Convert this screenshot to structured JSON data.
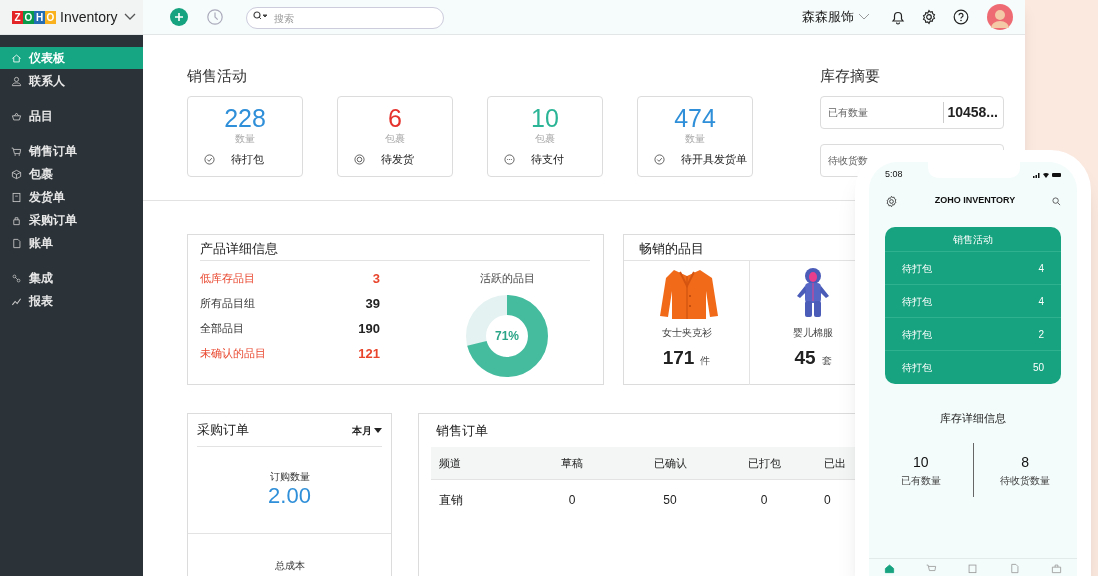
{
  "header": {
    "logo_letters": [
      "Z",
      "O",
      "H",
      "O"
    ],
    "product": "Inventory",
    "search": {
      "placeholder": "搜索"
    },
    "org": "森森服饰"
  },
  "sidebar": {
    "groups": [
      {
        "items": [
          {
            "label": "仪表板",
            "selected": true
          },
          {
            "label": "联系人",
            "selected": false
          }
        ]
      },
      {
        "items": [
          {
            "label": "品目",
            "selected": false
          }
        ]
      },
      {
        "items": [
          {
            "label": "销售订单",
            "selected": false
          },
          {
            "label": "包裹",
            "selected": false
          },
          {
            "label": "发货单",
            "selected": false
          },
          {
            "label": "采购订单",
            "selected": false
          },
          {
            "label": "账单",
            "selected": false
          }
        ]
      },
      {
        "items": [
          {
            "label": "集成",
            "selected": false
          },
          {
            "label": "报表",
            "selected": false
          }
        ]
      }
    ]
  },
  "sales_activity": {
    "title": "销售活动",
    "cards": [
      {
        "value": "228",
        "unit": "数量",
        "label": "待打包",
        "color": "#2f8fd8"
      },
      {
        "value": "6",
        "unit": "包裹",
        "label": "待发货",
        "color": "#e5322d"
      },
      {
        "value": "10",
        "unit": "包裹",
        "label": "待支付",
        "color": "#2bb596"
      },
      {
        "value": "474",
        "unit": "数量",
        "label": "待开具发货单",
        "color": "#2f8fd8"
      }
    ]
  },
  "inventory_summary": {
    "title": "库存摘要",
    "rows": [
      {
        "label": "已有数量",
        "value": "10458..."
      },
      {
        "label": "待收货数"
      }
    ]
  },
  "product_details": {
    "title": "产品详细信息",
    "rows": [
      {
        "label": "低库存品目",
        "value": "3",
        "alert": true
      },
      {
        "label": "所有品目组",
        "value": "39",
        "alert": false
      },
      {
        "label": "全部品目",
        "value": "190",
        "alert": false
      },
      {
        "label": "未确认的品目",
        "value": "121",
        "alert": true
      }
    ],
    "active": {
      "title": "活跃的品目",
      "level": 0.71,
      "reading": "71%"
    }
  },
  "top_selling": {
    "title": "畅销的品目",
    "items": [
      {
        "name": "女士夹克衫",
        "count": "171",
        "unit": "件"
      },
      {
        "name": "婴儿棉服",
        "count": "45",
        "unit": "套"
      }
    ]
  },
  "purchase_orders": {
    "title": "采购订单",
    "period": "本月",
    "qty_label": "订购数量",
    "qty": "2.00",
    "cost_label": "总成本"
  },
  "sales_orders": {
    "title": "销售订单",
    "columns": [
      "频道",
      "草稿",
      "已确认",
      "已打包",
      "已出"
    ],
    "rows": [
      [
        "直销",
        "0",
        "50",
        "0",
        "0"
      ]
    ]
  },
  "phone": {
    "time": "5:08",
    "title": "ZOHO INVENTORY",
    "activity": {
      "title": "销售活动",
      "rows": [
        {
          "label": "待打包",
          "value": "4"
        },
        {
          "label": "待打包",
          "value": "4"
        },
        {
          "label": "待打包",
          "value": "2"
        },
        {
          "label": "待打包",
          "value": "50"
        }
      ]
    },
    "stock": {
      "title": "库存详细信息",
      "items": [
        {
          "value": "10",
          "label": "已有数量"
        },
        {
          "value": "8",
          "label": "待收货数量"
        }
      ]
    },
    "nav": [
      {
        "selected": true
      },
      {
        "selected": false
      },
      {
        "selected": false
      },
      {
        "selected": false
      },
      {
        "selected": false
      }
    ]
  }
}
